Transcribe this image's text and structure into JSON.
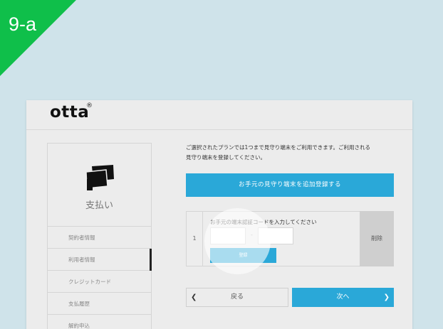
{
  "tutorial": {
    "step_label": "9-a"
  },
  "header": {
    "logo": "otta",
    "logo_mark": "®"
  },
  "sidebar": {
    "section_title": "支払い",
    "items": [
      {
        "label": "契約者情報"
      },
      {
        "label": "利用者情報"
      },
      {
        "label": "クレジットカード"
      },
      {
        "label": "支払履歴"
      },
      {
        "label": "解約申込"
      }
    ]
  },
  "main": {
    "info_line1": "ご選択されたプランでは1つまで見守り端末をご利用できます。ご利用される",
    "info_line2": "見守り端末を登録してください。",
    "add_device_button": "お手元の見守り端末を追加登録する",
    "device": {
      "index": "1",
      "prompt": "お手元の端末認証コードを入力してください",
      "separator": "-",
      "code1_value": "",
      "code2_value": "",
      "register_button": "登録",
      "delete_button": "削除"
    },
    "back_button": "戻る",
    "next_button": "次へ"
  },
  "colors": {
    "corner": "#0fbf4a",
    "accent": "#2aa8d8",
    "background": "#cfe3ea"
  }
}
